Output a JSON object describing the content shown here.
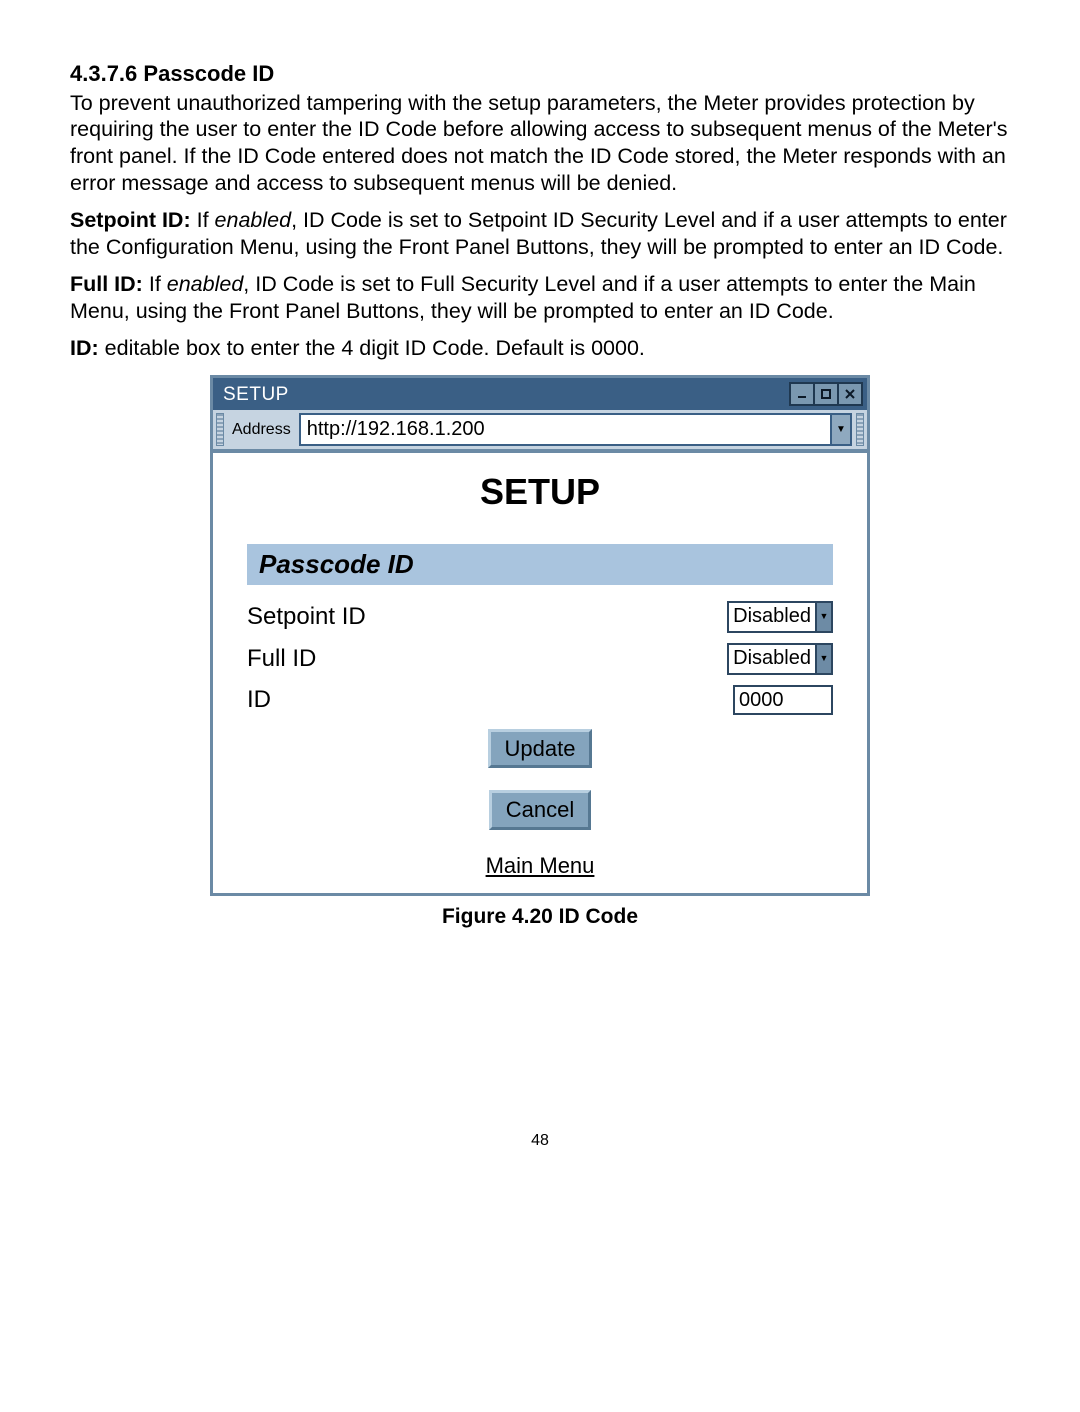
{
  "section": {
    "number": "4.3.7.6",
    "title": "Passcode ID"
  },
  "paragraphs": {
    "intro": "To prevent unauthorized tampering with the setup parameters, the Meter provides protection by requiring the user to enter the ID Code before allowing access to subsequent menus of the Meter's front panel. If the ID Code entered does not match the ID Code stored, the Meter responds with an error message and access to subsequent menus will be denied.",
    "setpoint_term": "Setpoint ID:",
    "setpoint_if": "If ",
    "setpoint_enabled": "enabled",
    "setpoint_rest": ", ID Code is set to Setpoint ID Security Level and if a user attempts to enter the Configuration Menu, using the Front Panel Buttons, they will be prompted to enter an ID Code.",
    "full_term": "Full ID:",
    "full_if": "If ",
    "full_enabled": "enabled",
    "full_rest": ", ID Code is set to Full Security Level and if a user attempts to enter the Main Menu, using the Front Panel Buttons, they will be prompted to enter an ID Code.",
    "id_term": "ID:",
    "id_rest": "editable box to enter the 4 digit ID Code. Default is 0000."
  },
  "window": {
    "title": "SETUP",
    "address_label": "Address",
    "address_value": "http://192.168.1.200",
    "page_heading": "SETUP",
    "panel_heading": "Passcode ID",
    "rows": {
      "setpoint_label": "Setpoint ID",
      "setpoint_value": "Disabled",
      "full_label": "Full ID",
      "full_value": "Disabled",
      "id_label": "ID",
      "id_value": "0000"
    },
    "buttons": {
      "update": "Update",
      "cancel": "Cancel",
      "main_menu": "Main Menu"
    }
  },
  "figure": {
    "label": "Figure 4.20  ID Code"
  },
  "page_number": "48"
}
